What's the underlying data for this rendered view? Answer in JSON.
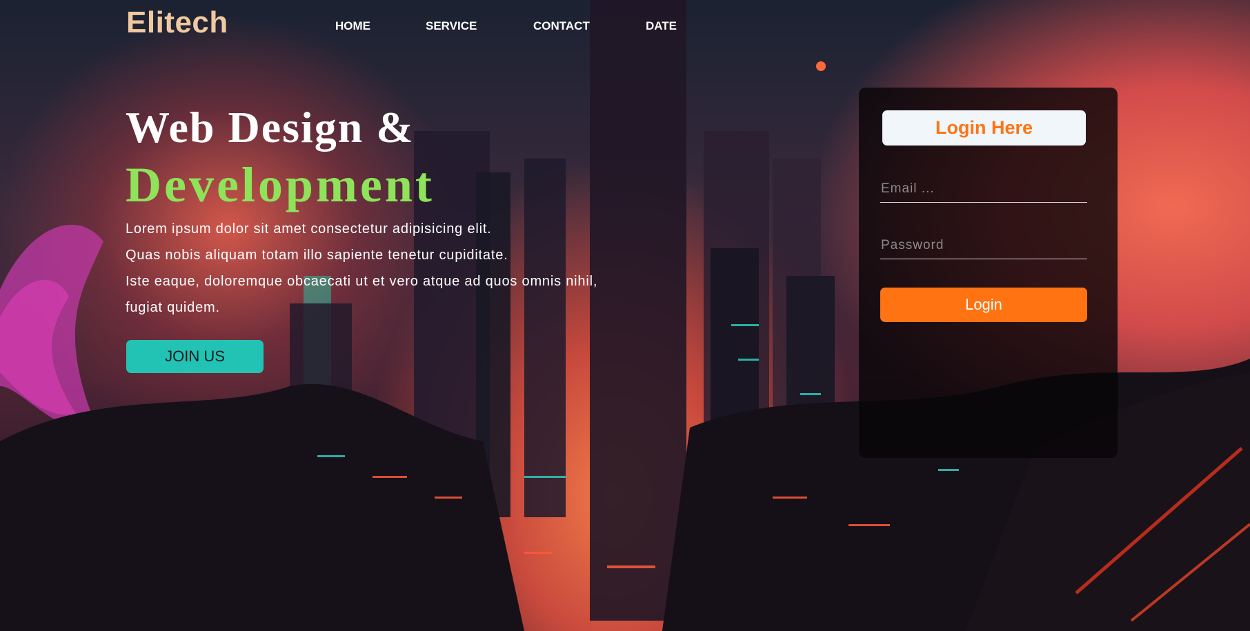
{
  "brand": {
    "logo": "Elitech"
  },
  "nav": {
    "items": [
      {
        "label": "HOME"
      },
      {
        "label": "SERVICE"
      },
      {
        "label": "CONTACT"
      },
      {
        "label": "DATE"
      }
    ]
  },
  "hero": {
    "title": "Web Design &",
    "accent": "Development",
    "paragraph_lines": [
      "Lorem ipsum dolor sit amet consectetur adipisicing elit.",
      "Quas nobis aliquam totam illo sapiente tenetur cupiditate.",
      "Iste eaque, doloremque obcaecati ut et vero atque ad quos omnis nihil,",
      "fugiat quidem."
    ],
    "cta_label": "JOIN US"
  },
  "login": {
    "title": "Login Here",
    "email": {
      "placeholder": "Email ...",
      "value": ""
    },
    "password": {
      "placeholder": "Password",
      "value": ""
    },
    "submit_label": "Login"
  },
  "colors": {
    "logo": "#f1c9a0",
    "accent_green": "#8ee35a",
    "cta_teal": "#22c3b4",
    "login_orange": "#ff7313",
    "card_title_bg": "#f1f6fb"
  }
}
